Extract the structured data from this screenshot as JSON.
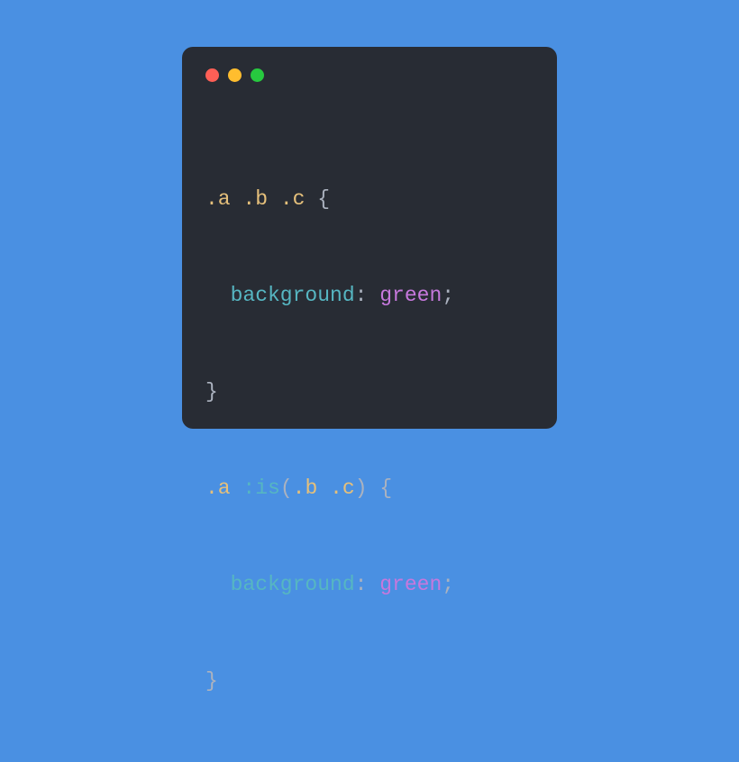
{
  "window": {
    "controls": {
      "close": "close",
      "minimize": "minimize",
      "maximize": "maximize"
    }
  },
  "code": {
    "rule1": {
      "selector_a": ".a",
      "selector_b": ".b",
      "selector_c": ".c",
      "open_brace": "{",
      "property": "background",
      "colon": ":",
      "value": "green",
      "semicolon": ";",
      "close_brace": "}"
    },
    "rule2": {
      "selector_a": ".a",
      "pseudo": ":is",
      "paren_open": "(",
      "selector_b": ".b",
      "selector_c": ".c",
      "paren_close": ")",
      "open_brace": "{",
      "property": "background",
      "colon": ":",
      "value": "green",
      "semicolon": ";",
      "close_brace": "}"
    },
    "space": " "
  }
}
